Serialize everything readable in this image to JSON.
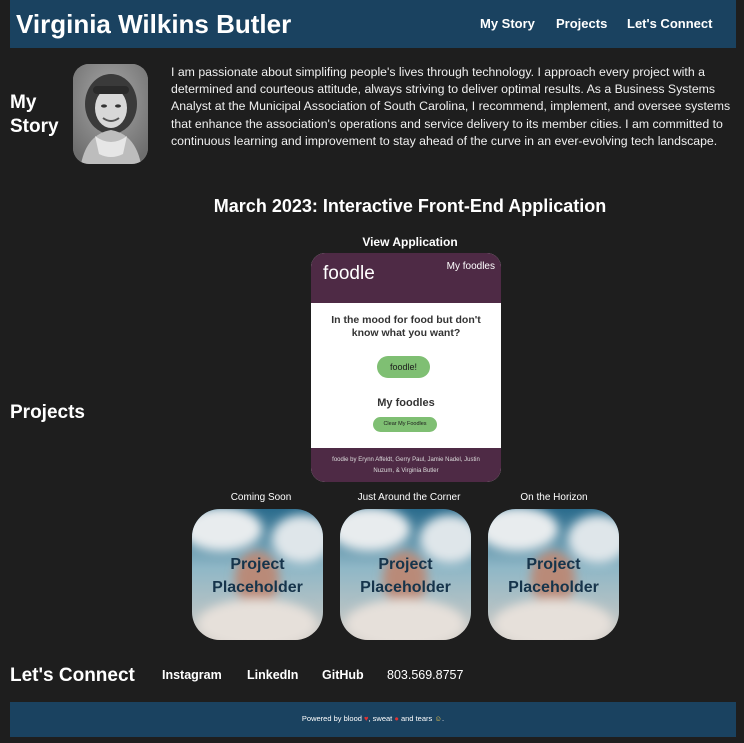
{
  "header": {
    "site_title": "Virginia Wilkins Butler",
    "nav": [
      "My Story",
      "Projects",
      "Let's Connect"
    ]
  },
  "my_story": {
    "label": "My Story",
    "bio": "I am passionate about simplifing people's lives through technology. I approach every project with a determined and courteous attitude, always striving to deliver optimal results. As a Business Systems Analyst at the Municipal Association of South Carolina, I recommend, implement, and oversee systems that enhance the association's operations and service delivery to its member cities. I am committed to continuous learning and improvement to stay ahead of the curve in an ever-evolving tech landscape."
  },
  "projects": {
    "label": "Projects",
    "featured_title": "March 2023: Interactive Front-End Application",
    "view_link": "View Application",
    "app_preview": {
      "logo": "foodle",
      "my_foodles_link": "My foodles",
      "prompt": "In the mood for food but don't know what you want?",
      "button": "foodle!",
      "subheading": "My foodles",
      "clear_button": "Clear My Foodles",
      "footer": "foodie by Erynn Affeldt, Gerry Paul, Jamie Nadel, Justin Nuzum, & Virginia Butler"
    },
    "placeholders": [
      {
        "caption": "Coming Soon",
        "line1": "Project",
        "line2": "Placeholder"
      },
      {
        "caption": "Just Around the Corner",
        "line1": "Project",
        "line2": "Placeholder"
      },
      {
        "caption": "On the Horizon",
        "line1": "Project",
        "line2": "Placeholder"
      }
    ]
  },
  "connect": {
    "label": "Let's Connect",
    "links": [
      "Instagram",
      "LinkedIn",
      "GitHub"
    ],
    "phone": "803.569.8757"
  },
  "footer": {
    "text_start": "Powered by blood",
    "text_mid1": ", sweat",
    "text_mid2": "and tears"
  },
  "colors": {
    "background": "#1e1e1e",
    "banner": "#1a4260",
    "app_header": "#4e2a45",
    "app_button": "#7fbf73"
  }
}
